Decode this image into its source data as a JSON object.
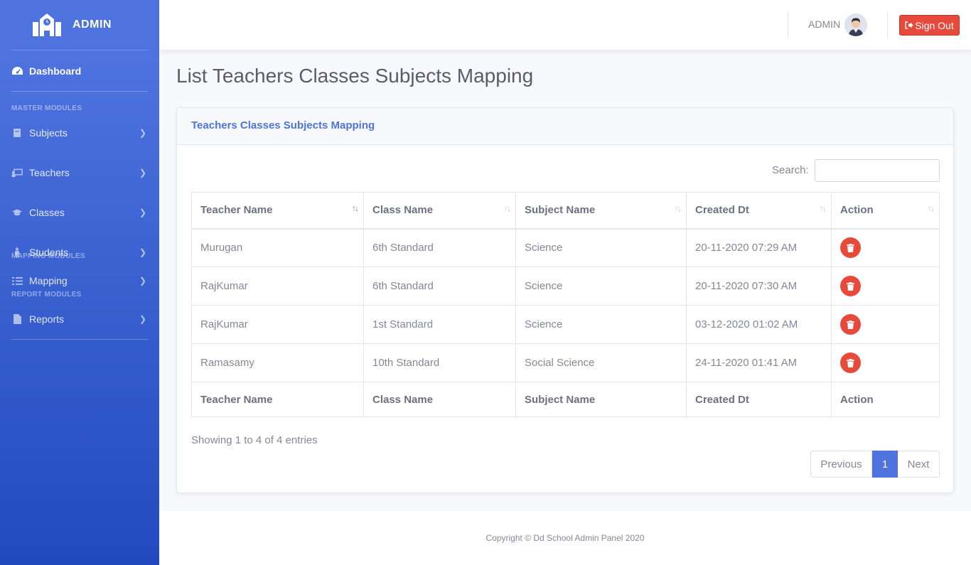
{
  "brand": {
    "name": "ADMIN"
  },
  "sidebar": {
    "dashboard": "Dashboard",
    "headings": {
      "master": "MASTER MODULES",
      "mapping": "MAPPING MODULES",
      "report": "REPORT MODULES"
    },
    "items": [
      {
        "label": "Subjects",
        "icon": "book-icon"
      },
      {
        "label": "Teachers",
        "icon": "chalkboard-teacher-icon"
      },
      {
        "label": "Classes",
        "icon": "graduation-cap-icon"
      },
      {
        "label": "Students",
        "icon": "student-icon"
      },
      {
        "label": "Mapping",
        "icon": "list-icon"
      },
      {
        "label": "Reports",
        "icon": "file-icon"
      }
    ]
  },
  "topbar": {
    "user": "ADMIN",
    "signout": "Sign Out"
  },
  "page": {
    "title": "List Teachers Classes Subjects Mapping"
  },
  "card": {
    "title": "Teachers Classes Subjects Mapping",
    "search_label": "Search:",
    "search_value": "",
    "columns": [
      "Teacher Name",
      "Class Name",
      "Subject Name",
      "Created Dt",
      "Action"
    ],
    "rows": [
      [
        "Murugan",
        "6th Standard",
        "Science",
        "20-11-2020 07:29 AM"
      ],
      [
        "RajKumar",
        "6th Standard",
        "Science",
        "20-11-2020 07:30 AM"
      ],
      [
        "RajKumar",
        "1st Standard",
        "Science",
        "03-12-2020 01:02 AM"
      ],
      [
        "Ramasamy",
        "10th Standard",
        "Social Science",
        "24-11-2020 01:41 AM"
      ]
    ],
    "info": "Showing 1 to 4 of 4 entries",
    "pagination": {
      "previous": "Previous",
      "current": "1",
      "next": "Next"
    }
  },
  "footer": {
    "text": "Copyright © Dd School Admin Panel 2020"
  },
  "colors": {
    "primary": "#4e73df",
    "danger": "#e74a3b"
  }
}
